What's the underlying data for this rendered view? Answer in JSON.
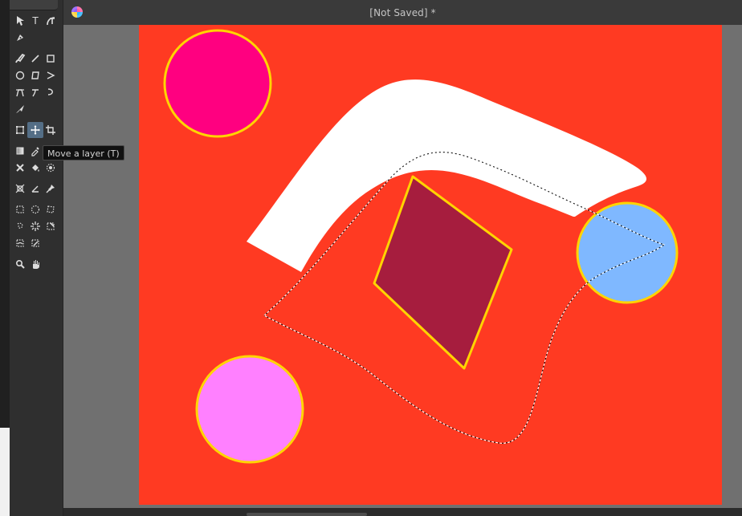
{
  "window": {
    "title": "[Not Saved]  *"
  },
  "toolbox": {
    "tooltip": "Move a layer (T)",
    "tools": [
      {
        "icon": "select-arrow-icon"
      },
      {
        "icon": "text-icon",
        "glyph": "T"
      },
      {
        "icon": "text-path-icon"
      },
      {
        "icon": "calligraphy-pen-icon"
      },
      {
        "icon": "brush-icon"
      },
      {
        "icon": "line-icon"
      },
      {
        "icon": "rectangle-icon"
      },
      {
        "icon": "ellipse-icon"
      },
      {
        "icon": "polygon-icon"
      },
      {
        "icon": "polyline-icon"
      },
      {
        "icon": "bezier-icon"
      },
      {
        "icon": "freehand-path-icon"
      },
      {
        "icon": "dynamic-brush-icon"
      },
      {
        "icon": "multibrush-icon"
      },
      {
        "icon": "transform-icon"
      },
      {
        "icon": "move-icon"
      },
      {
        "icon": "crop-icon"
      },
      {
        "icon": "gradient-icon"
      },
      {
        "icon": "color-picker-icon"
      },
      {
        "icon": "smart-patch-icon"
      },
      {
        "icon": "fill-icon"
      },
      {
        "icon": "enclose-fill-icon"
      },
      {
        "icon": "assistant-icon"
      },
      {
        "icon": "measure-icon"
      },
      {
        "icon": "reference-icon"
      },
      {
        "icon": "rect-select-icon"
      },
      {
        "icon": "ellipse-select-icon"
      },
      {
        "icon": "polygon-select-icon"
      },
      {
        "icon": "freehand-select-icon"
      },
      {
        "icon": "contiguous-select-icon"
      },
      {
        "icon": "similar-select-icon"
      },
      {
        "icon": "bezier-select-icon"
      },
      {
        "icon": "magnetic-select-icon"
      },
      {
        "icon": "zoom-icon"
      },
      {
        "icon": "pan-icon"
      }
    ]
  },
  "canvas": {
    "background": "#ff3a22",
    "shapes": {
      "magenta_circle": "#ff0080",
      "pink_circle": "#ff80ff",
      "blue_circle": "#7fb8ff",
      "purple_rhombus": "#a61d3e",
      "outline": "#ffd400",
      "white_band": "#ffffff"
    }
  }
}
